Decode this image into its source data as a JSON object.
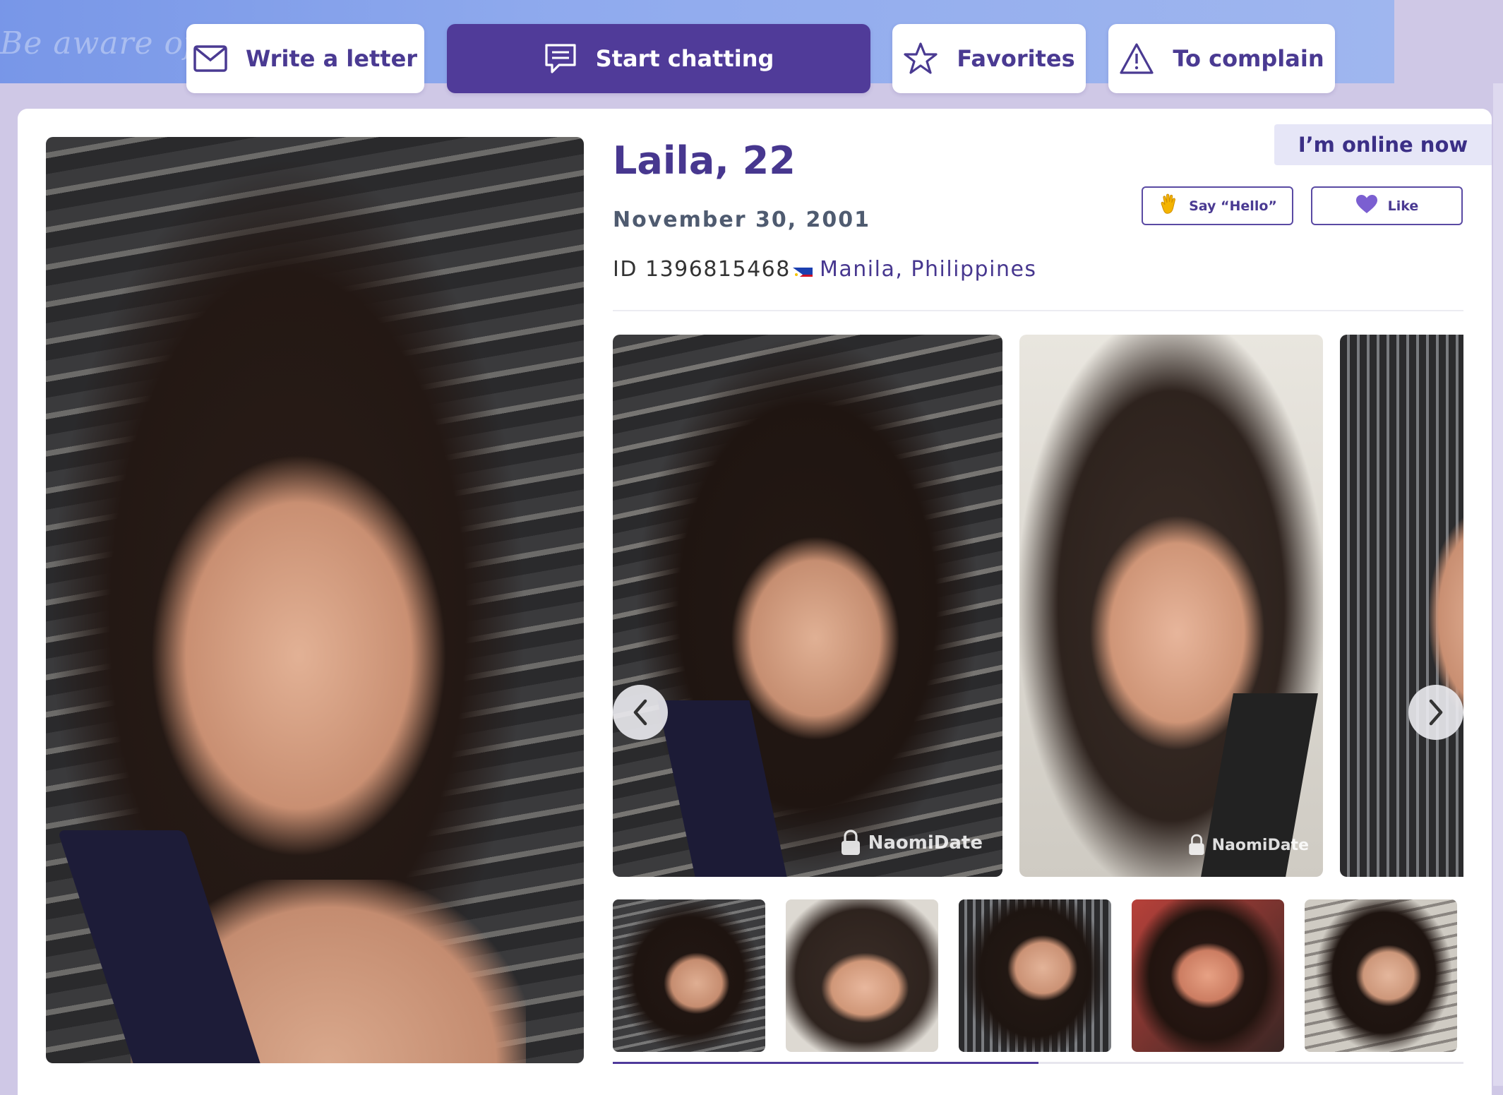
{
  "background": {
    "banner_text": "Be aware of all"
  },
  "actions": {
    "write_letter": "Write a letter",
    "start_chatting": "Start chatting",
    "favorites": "Favorites",
    "complain": "To complain"
  },
  "profile": {
    "name_age": "Laila, 22",
    "birth_date": "November 30, 2001",
    "id_text": "ID 1396815468",
    "location": "Manila, Philippines",
    "online_status": "I’m online now",
    "say_hello": "Say “Hello”",
    "like": "Like"
  },
  "gallery": {
    "watermark": "NaomiDate",
    "photo_count_visible": 3,
    "thumbnails_visible": 5,
    "progress_fraction": 0.5
  },
  "colors": {
    "brand_purple": "#503b99",
    "text_purple": "#47378f",
    "online_bg": "#e6e6f7"
  },
  "icons": [
    "envelope-icon",
    "chat-icon",
    "star-icon",
    "warning-icon",
    "waving-hand-icon",
    "heart-icon",
    "chevron-left-icon",
    "chevron-right-icon",
    "philippines-flag-icon",
    "lock-icon"
  ]
}
